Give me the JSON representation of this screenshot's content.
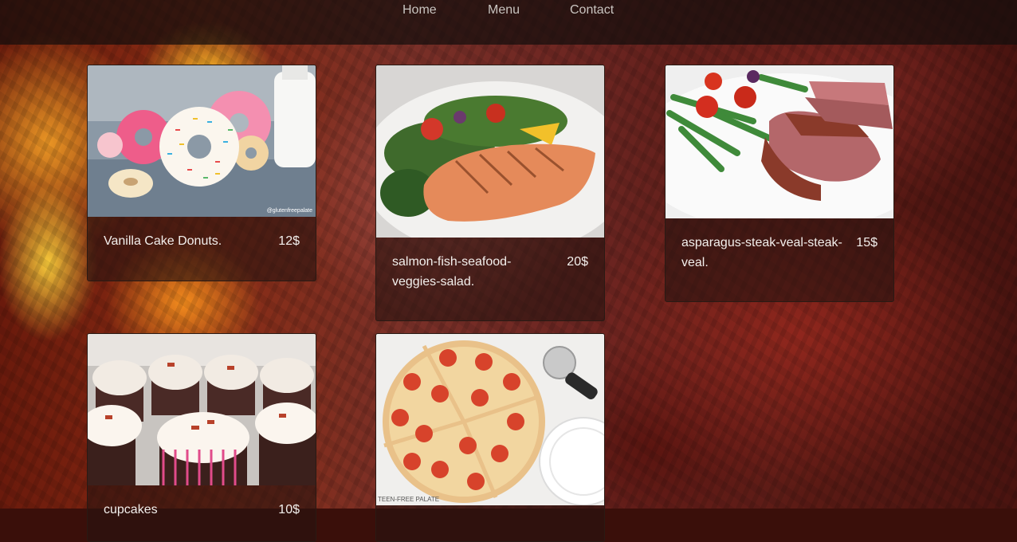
{
  "nav": {
    "home": "Home",
    "menu": "Menu",
    "contact": "Contact"
  },
  "menu_items": [
    {
      "name": "Vanilla Cake Donuts.",
      "price": "12$",
      "watermark": "@glutenfreepalate"
    },
    {
      "name": "salmon-fish-seafood-veggies-salad.",
      "price": "20$"
    },
    {
      "name": "asparagus-steak-veal-steak-veal.",
      "price": "15$"
    },
    {
      "name": "cupcakes",
      "price": "10$"
    },
    {
      "name": "",
      "price": "",
      "watermark": "TEEN-FREE PALATE"
    }
  ],
  "colors": {
    "nav_bg": "#140e0c",
    "card_bg": "#281410",
    "text": "#f3efec"
  }
}
